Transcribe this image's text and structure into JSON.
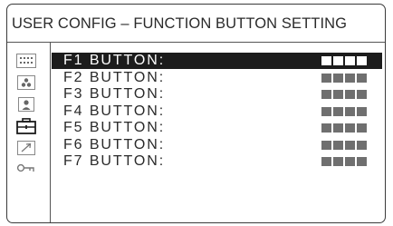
{
  "window": {
    "title": "USER CONFIG – FUNCTION BUTTON SETTING"
  },
  "sidebar": {
    "icons": [
      "grid-icon",
      "three-dots-icon",
      "person-icon",
      "toolbox-icon",
      "arrow-icon",
      "key-icon"
    ],
    "selected": "toolbox-icon"
  },
  "menu": {
    "selected_index": 0,
    "items": [
      {
        "label": "F1 BUTTON:"
      },
      {
        "label": "F2 BUTTON:"
      },
      {
        "label": "F3 BUTTON:"
      },
      {
        "label": "F4 BUTTON:"
      },
      {
        "label": "F5 BUTTON:"
      },
      {
        "label": "F6 BUTTON:"
      },
      {
        "label": "F7 BUTTON:"
      }
    ]
  },
  "colors": {
    "selected_row": "#1c1c1c",
    "value_blocks": "#6f6f6f"
  }
}
